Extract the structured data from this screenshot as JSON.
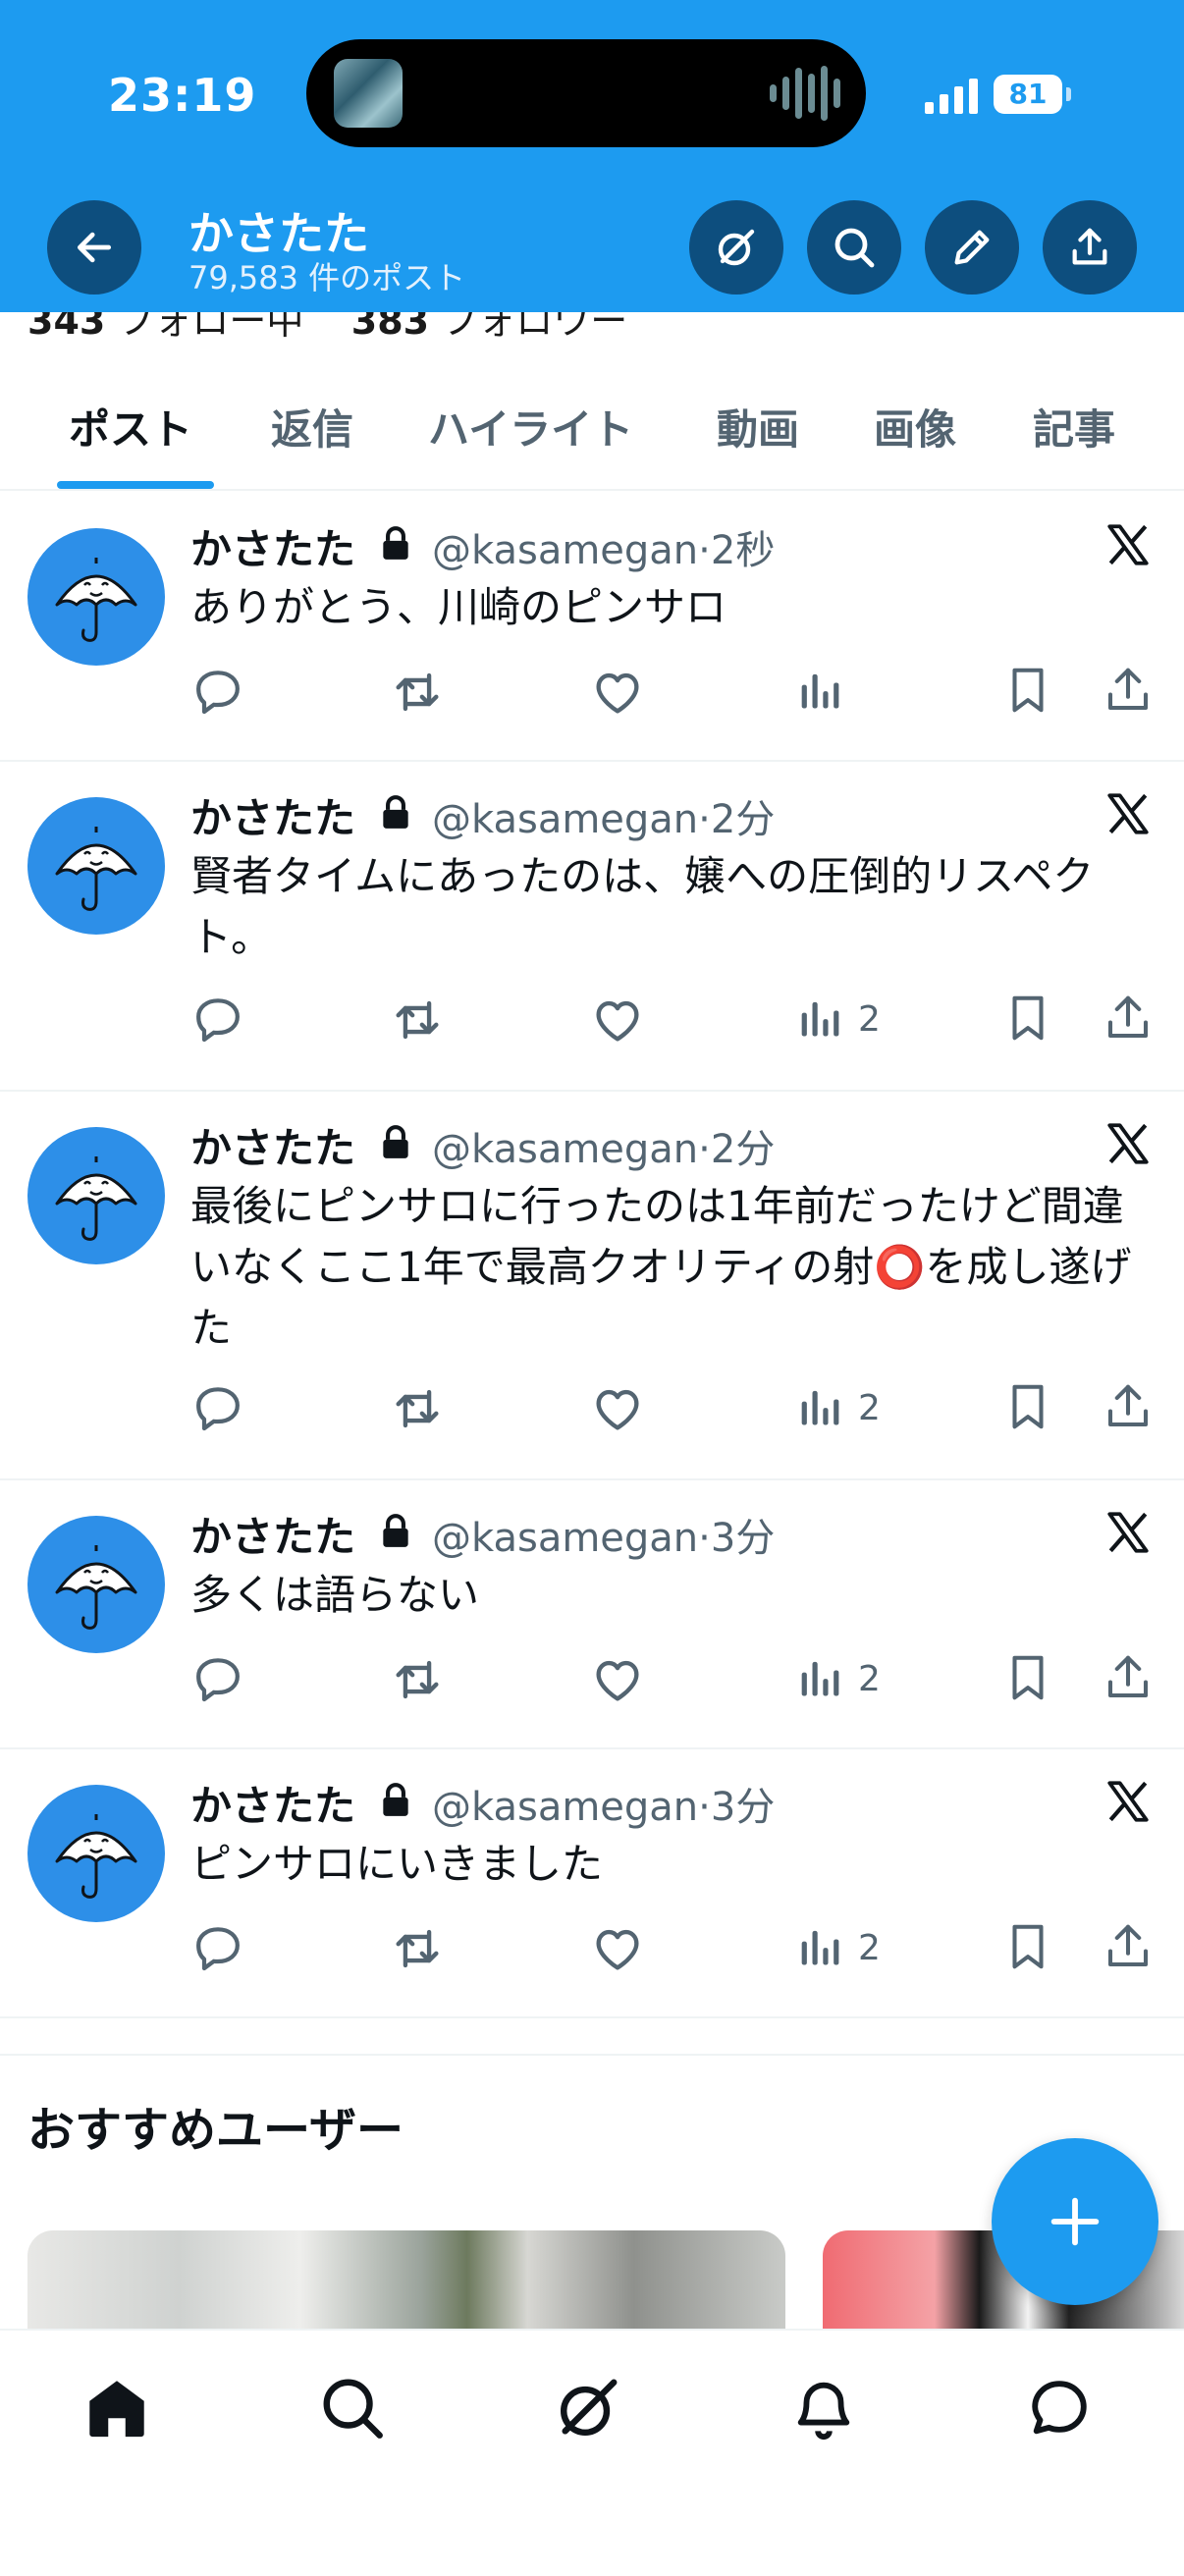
{
  "status_bar": {
    "time": "23:19",
    "battery": "81"
  },
  "header": {
    "name": "かさたた",
    "post_count": "79,583 件のポスト"
  },
  "profile_peek": {
    "following_count": "343",
    "following_label": "フォロー中",
    "followers_count": "383",
    "followers_label": "フォロワー"
  },
  "tabs": [
    {
      "label": "ポスト",
      "active": true
    },
    {
      "label": "返信"
    },
    {
      "label": "ハイライト"
    },
    {
      "label": "動画"
    },
    {
      "label": "画像"
    },
    {
      "label": "記事"
    }
  ],
  "posts": [
    {
      "name": "かさたた",
      "handle": "@kasamegan",
      "time": "2秒",
      "text": "ありがとう、川崎のピンサロ",
      "views": ""
    },
    {
      "name": "かさたた",
      "handle": "@kasamegan",
      "time": "2分",
      "text": "賢者タイムにあったのは、嬢への圧倒的リスペクト。",
      "views": "2"
    },
    {
      "name": "かさたた",
      "handle": "@kasamegan",
      "time": "2分",
      "text": "最後にピンサロに行ったのは1年前だったけど間違いなくここ1年で最高クオリティの射⭕️を成し遂げた",
      "views": "2"
    },
    {
      "name": "かさたた",
      "handle": "@kasamegan",
      "time": "3分",
      "text": "多くは語らない",
      "views": "2"
    },
    {
      "name": "かさたた",
      "handle": "@kasamegan",
      "time": "3分",
      "text": "ピンサロにいきました",
      "views": "2"
    }
  ],
  "recommended": {
    "title": "おすすめユーザー"
  },
  "colors": {
    "accent": "#1d9bf0",
    "header_button": "#0d4e7e",
    "text": "#0f1419",
    "muted": "#536471"
  },
  "icons": {
    "header": [
      "back-arrow-icon",
      "grok-icon",
      "search-icon",
      "edit-icon",
      "share-icon"
    ],
    "post_actions": [
      "reply-icon",
      "repost-icon",
      "like-icon",
      "views-icon",
      "bookmark-icon",
      "share-icon"
    ],
    "nav": [
      "home-icon",
      "search-icon",
      "grok-icon",
      "notifications-icon",
      "messages-icon"
    ]
  }
}
